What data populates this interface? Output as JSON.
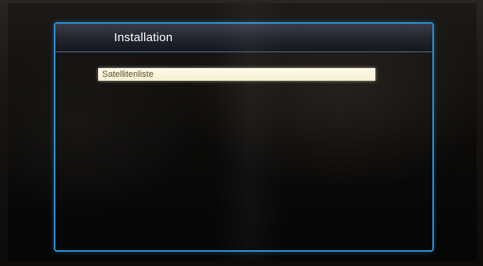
{
  "menu": {
    "title": "Installation",
    "items": [
      {
        "label": "Satellitenliste",
        "selected": true
      }
    ]
  },
  "colors": {
    "frame_accent": "#2b8fd2",
    "highlight": "#fffbe8",
    "title_text": "#ffffff"
  }
}
